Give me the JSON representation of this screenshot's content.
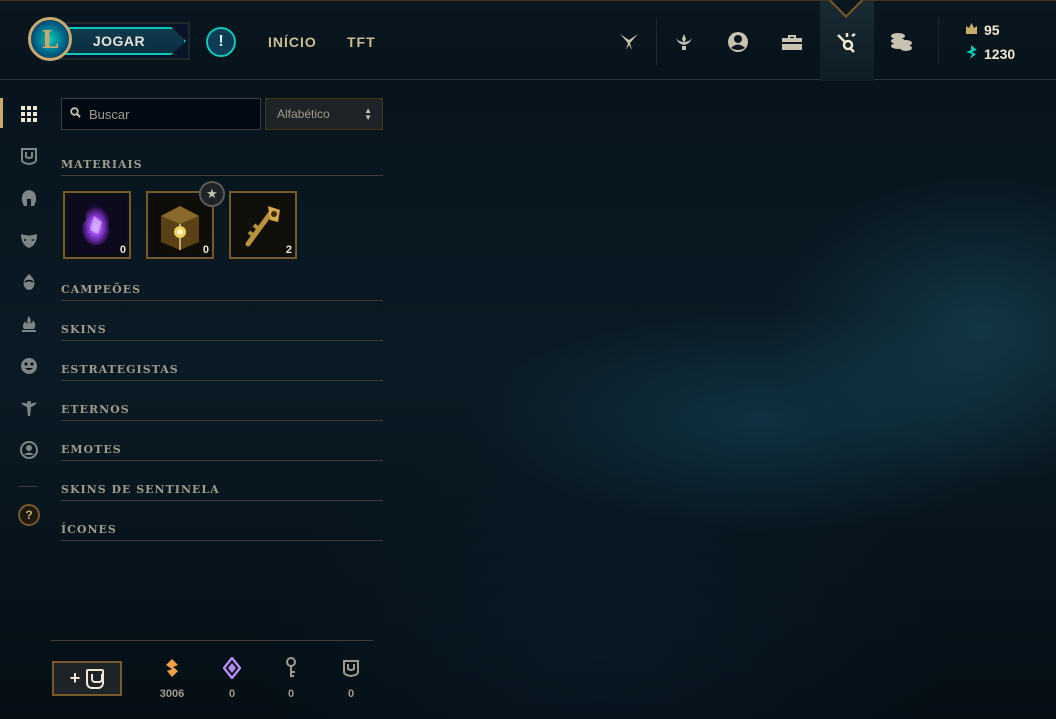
{
  "topbar": {
    "logo_letter": "L",
    "play_label": "JOGAR",
    "alert_symbol": "!",
    "nav": [
      "INÍCIO",
      "TFT"
    ],
    "icons": [
      "swords-icon",
      "trophy-icon",
      "profile-icon",
      "collection-icon",
      "loot-icon",
      "store-icon"
    ],
    "active_icon": "loot-icon",
    "currencies": [
      {
        "name": "blue-essence-icon",
        "value": "95",
        "color": "#c8aa6e"
      },
      {
        "name": "riot-points-icon",
        "value": "1230",
        "color": "#0ac8b9"
      }
    ]
  },
  "sidebar": {
    "icons": [
      "grid-icon",
      "chest-icon",
      "helmet-icon",
      "mask-icon",
      "egg-icon",
      "flame-icon",
      "emote-face-icon",
      "ward-icon",
      "profile-icon"
    ],
    "active": "grid-icon",
    "help": "?"
  },
  "filters": {
    "search_placeholder": "Buscar",
    "sort_value": "Alfabético"
  },
  "categories": {
    "materiais": "MATERIAIS",
    "campeoes": "CAMPEÕES",
    "skins": "SKINS",
    "estrategistas": "ESTRATEGISTAS",
    "eternos": "ETERNOS",
    "emotes": "EMOTES",
    "skins_sentinela": "SKINS DE SENTINELA",
    "icones": "ÍCONES"
  },
  "materials": [
    {
      "name": "mythic-essence-icon",
      "count": "0"
    },
    {
      "name": "masterwork-chest-icon",
      "count": "0"
    },
    {
      "name": "hextech-key-icon",
      "count": "2"
    }
  ],
  "bottom": {
    "add_label": "+",
    "resources": [
      {
        "name": "orange-essence-icon",
        "value": "3006",
        "color": "#f0a04a"
      },
      {
        "name": "mythic-essence-icon",
        "value": "0",
        "color": "#b48cf0"
      },
      {
        "name": "key-fragment-icon",
        "value": "0",
        "color": "#a09b8c"
      },
      {
        "name": "chest-icon",
        "value": "0",
        "color": "#a09b8c"
      }
    ]
  }
}
